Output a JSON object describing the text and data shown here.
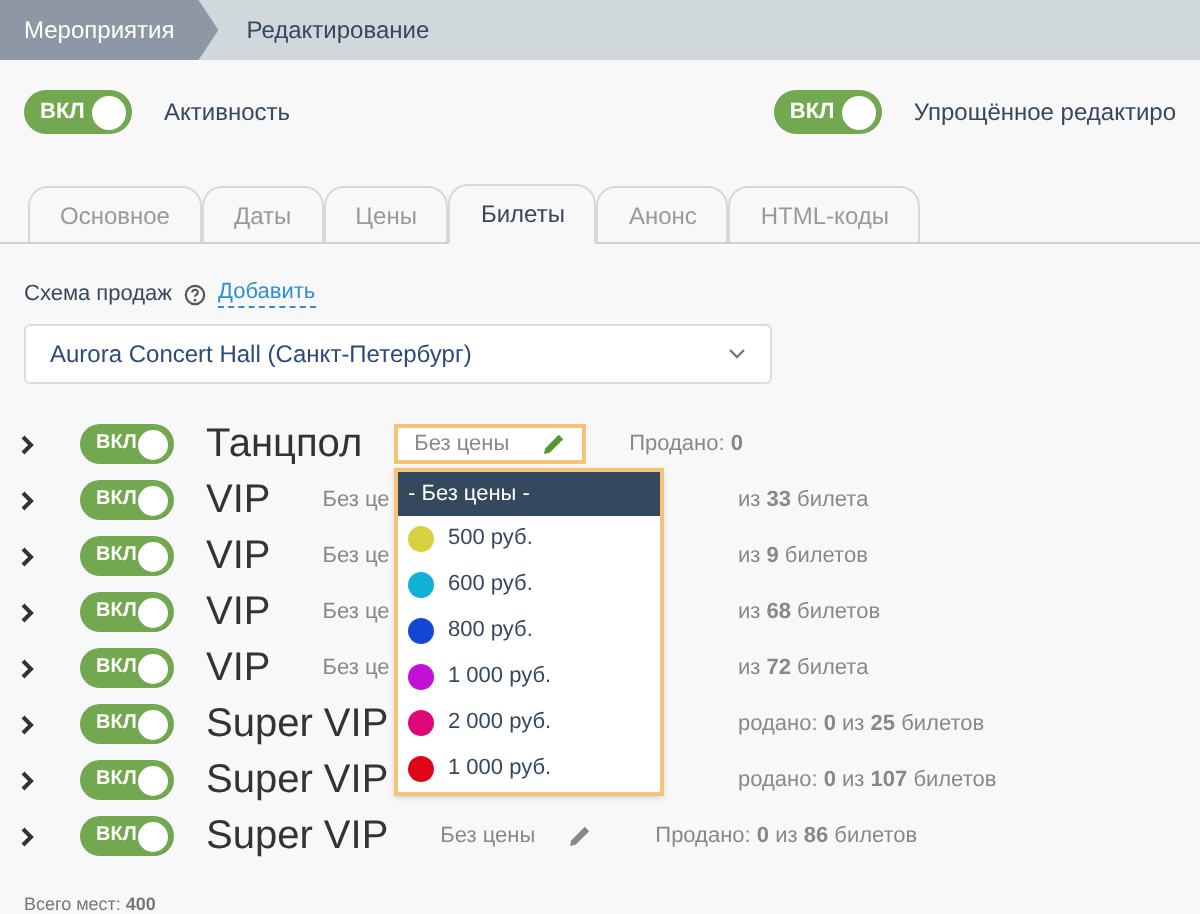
{
  "breadcrumbs": [
    {
      "label": "Мероприятия",
      "selected": false
    },
    {
      "label": "Редактирование",
      "selected": true
    }
  ],
  "switches": [
    {
      "toggle": "ВКЛ",
      "on": true,
      "label": "Активность"
    },
    {
      "toggle": "ВКЛ",
      "on": true,
      "label": "Упрощённое редактиро"
    }
  ],
  "tabs": [
    {
      "label": "Основное",
      "selected": false
    },
    {
      "label": "Даты",
      "selected": false
    },
    {
      "label": "Цены",
      "selected": false
    },
    {
      "label": "Билеты",
      "selected": true
    },
    {
      "label": "Анонс",
      "selected": false
    },
    {
      "label": "HTML-коды",
      "selected": false
    }
  ],
  "sales_scheme": {
    "label": "Схема продаж",
    "add_link": "Добавить",
    "value": "Aurora Concert Hall (Санкт-Петербург)"
  },
  "tickets": [
    {
      "kind": "full",
      "toggle": "ВКЛ",
      "on": true,
      "name": "Танцпол",
      "price": "Без цены",
      "editing": true,
      "sold": "Продано: **0**"
    },
    {
      "kind": "covered",
      "toggle": "ВКЛ",
      "on": true,
      "name": "VIP",
      "price": "Без це",
      "sold": "из **33** билета"
    },
    {
      "kind": "covered",
      "toggle": "ВКЛ",
      "on": true,
      "name": "VIP",
      "price": "Без це",
      "sold": "из **9** билетов"
    },
    {
      "kind": "covered",
      "toggle": "ВКЛ",
      "on": true,
      "name": "VIP",
      "price": "Без це",
      "sold": "из **68** билетов"
    },
    {
      "kind": "covered",
      "toggle": "ВКЛ",
      "on": true,
      "name": "VIP",
      "price": "Без це",
      "sold": "из **72** билета"
    },
    {
      "kind": "covered",
      "toggle": "ВКЛ",
      "on": true,
      "name": "Super VIP",
      "sold": "родано: **0** из **25** билетов"
    },
    {
      "kind": "covered",
      "toggle": "ВКЛ",
      "on": true,
      "name": "Super VIP",
      "sold": "родано: **0** из **107** билетов"
    },
    {
      "kind": "full",
      "toggle": "ВКЛ",
      "on": true,
      "name": "Super VIP",
      "price": "Без цены",
      "editing": false,
      "sold": "Продано: **0** из **86** билетов"
    }
  ],
  "price_dropdown": {
    "options": [
      {
        "label": "- Без цены -",
        "selected": true
      },
      {
        "label": "500 руб.",
        "color": "#d6d23f",
        "selected": false
      },
      {
        "label": "600 руб.",
        "color": "#13b0d6",
        "selected": false
      },
      {
        "label": "800 руб.",
        "color": "#1448d4",
        "selected": false
      },
      {
        "label": "1 000 руб.",
        "color": "#c40fd6",
        "selected": false
      },
      {
        "label": "2 000 руб.",
        "color": "#e0077a",
        "selected": false
      },
      {
        "label": "1 000 руб.",
        "color": "#e0061a",
        "selected": false
      }
    ]
  },
  "total": "Всего мест: **400**"
}
